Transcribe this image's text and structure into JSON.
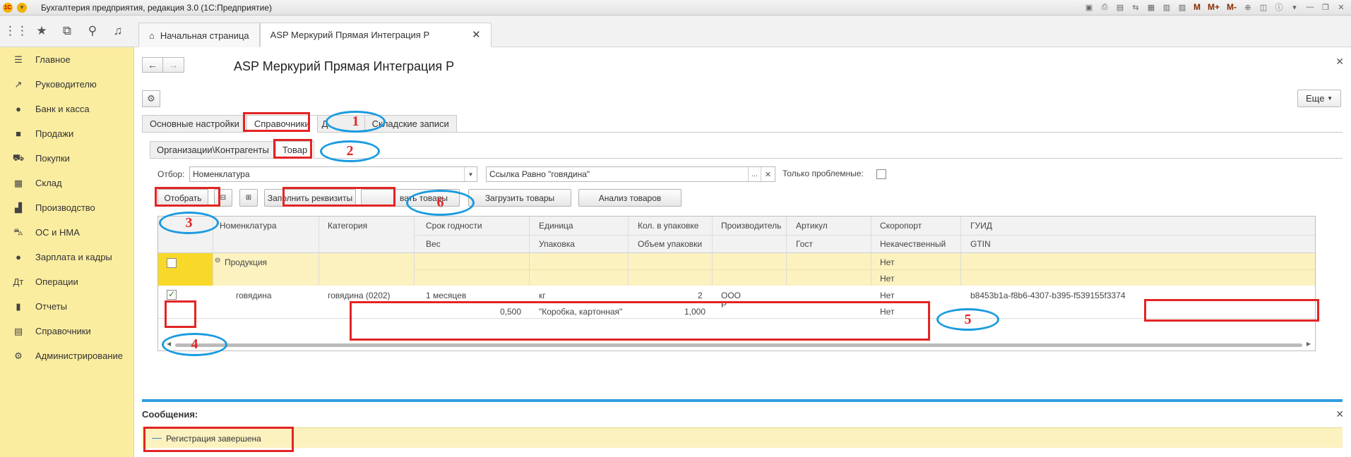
{
  "app": {
    "window_title": "Бухгалтерия предприятия, редакция 3.0  (1С:Предприятие)",
    "tb_m": "M",
    "tb_mplus": "M+",
    "tb_mminus": "M-"
  },
  "tabs": {
    "home": "Начальная страница",
    "current": "ASP Меркурий Прямая Интеграция Р"
  },
  "sidebar": {
    "items": [
      {
        "label": "Главное",
        "icon": "menu-icon"
      },
      {
        "label": "Руководителю",
        "icon": "chart-icon"
      },
      {
        "label": "Банк и касса",
        "icon": "coin-icon"
      },
      {
        "label": "Продажи",
        "icon": "bag-icon"
      },
      {
        "label": "Покупки",
        "icon": "cart-icon"
      },
      {
        "label": "Склад",
        "icon": "warehouse-icon"
      },
      {
        "label": "Производство",
        "icon": "factory-icon"
      },
      {
        "label": "ОС и НМА",
        "icon": "truck-icon"
      },
      {
        "label": "Зарплата и кадры",
        "icon": "person-icon"
      },
      {
        "label": "Операции",
        "icon": "operations-icon"
      },
      {
        "label": "Отчеты",
        "icon": "reports-icon"
      },
      {
        "label": "Справочники",
        "icon": "book-icon"
      },
      {
        "label": "Администрирование",
        "icon": "gear-icon"
      }
    ]
  },
  "form": {
    "title": "ASP Меркурий Прямая Интеграция Р",
    "more_label": "Еще",
    "tabs_main": [
      "Основные настройки",
      "Справочники",
      "Д",
      "Складские записи"
    ],
    "tabs_sub": [
      "Организации\\Контрагенты",
      "Товар"
    ],
    "filter_label": "Отбор:",
    "filter_field": "Номенклатура",
    "filter_value": "Ссылка Равно \"говядина\"",
    "only_problem_label": "Только проблемные:",
    "buttons": {
      "select": "Отобрать",
      "fill": "Заполнить реквизиты",
      "send_partial": "вать товары",
      "load": "Загрузить товары",
      "analyze": "Анализ товаров"
    }
  },
  "grid": {
    "headers_top": [
      "Номенклатура",
      "Категория",
      "Срок годности",
      "Единица",
      "Кол. в упаковке",
      "Производитель",
      "Артикул",
      "Скоропорт",
      "ГУИД"
    ],
    "headers_bottom": [
      "Вес",
      "Упаковка",
      "Объем упаковки",
      "Гост",
      "Некачественный",
      "GTIN"
    ],
    "group_row": {
      "name": "Продукция",
      "perishable": "Нет",
      "defective": "Нет"
    },
    "item_row": {
      "name": "говядина",
      "category": "говядина (0202)",
      "shelf_life": "1 месяцев",
      "weight": "0,500",
      "unit": "кг",
      "package": "\"Коробка, картонная\"",
      "qty_in_package": "2",
      "package_volume": "1,000",
      "manufacturer_1": "ООО",
      "manufacturer_2": "Р",
      "perishable": "Нет",
      "defective": "Нет",
      "guid": "b8453b1a-f8b6-4307-b395-f539155f3374",
      "checked": true
    }
  },
  "messages": {
    "title": "Сообщения:",
    "text": "Регистрация завершена"
  },
  "annotations": [
    "1",
    "2",
    "3",
    "4",
    "5",
    "6"
  ]
}
